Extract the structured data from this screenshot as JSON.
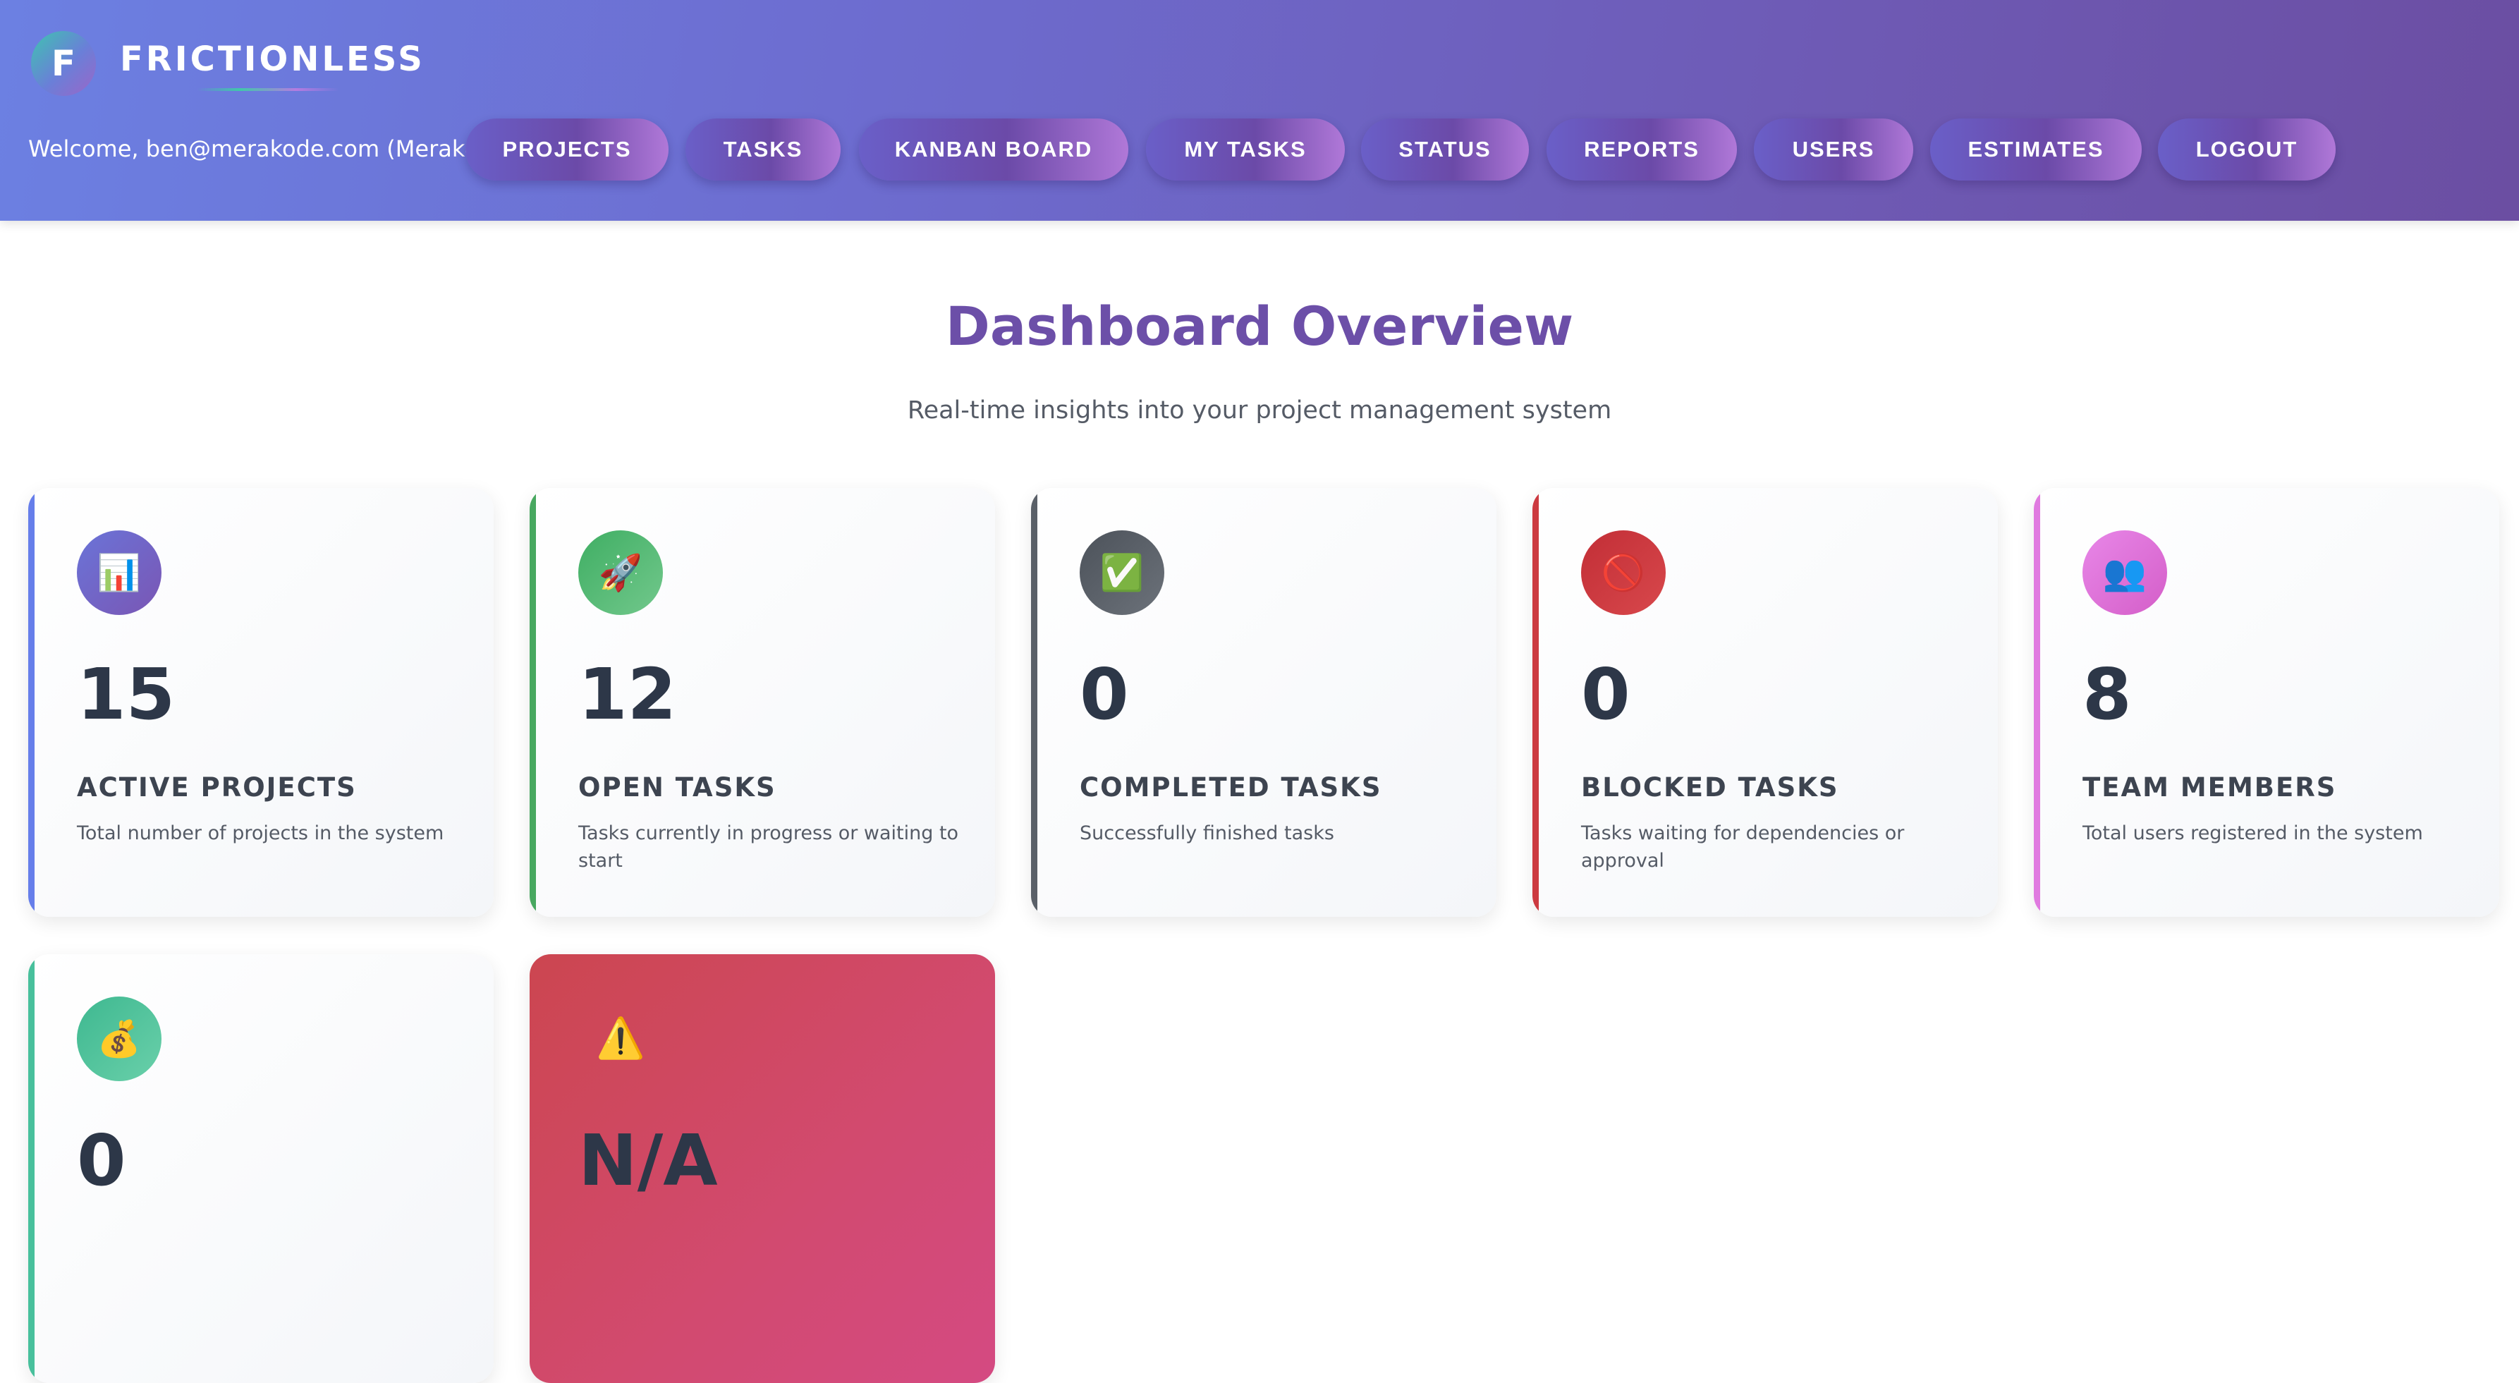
{
  "header": {
    "logo_letter": "F",
    "brand": "FRICTIONLESS",
    "welcome": "Welcome, ben@merakode.com (Merakode)",
    "nav": [
      {
        "label": "PROJECTS"
      },
      {
        "label": "TASKS"
      },
      {
        "label": "KANBAN BOARD"
      },
      {
        "label": "MY TASKS"
      },
      {
        "label": "STATUS"
      },
      {
        "label": "REPORTS"
      },
      {
        "label": "USERS"
      },
      {
        "label": "ESTIMATES"
      },
      {
        "label": "LOGOUT"
      }
    ]
  },
  "main": {
    "title": "Dashboard Overview",
    "subtitle": "Real-time insights into your project management system",
    "cards": [
      {
        "icon": "bar-chart-icon",
        "glyph": "📊",
        "value": "15",
        "label": "ACTIVE PROJECTS",
        "description": "Total number of projects in the system",
        "accent": "#667eea"
      },
      {
        "icon": "rocket-icon",
        "glyph": "🚀",
        "value": "12",
        "label": "OPEN TASKS",
        "description": "Tasks currently in progress or waiting to start",
        "accent": "#48a860"
      },
      {
        "icon": "check-mark-icon",
        "glyph": "✅",
        "value": "0",
        "label": "COMPLETED TASKS",
        "description": "Successfully finished tasks",
        "accent": "#5a6068"
      },
      {
        "icon": "prohibited-icon",
        "glyph": "🚫",
        "value": "0",
        "label": "BLOCKED TASKS",
        "description": "Tasks waiting for dependencies or approval",
        "accent": "#cc3a40"
      },
      {
        "icon": "people-icon",
        "glyph": "👥",
        "value": "8",
        "label": "TEAM MEMBERS",
        "description": "Total users registered in the system",
        "accent": "#e07ae0"
      },
      {
        "icon": "money-bag-icon",
        "glyph": "💰",
        "value": "0",
        "label": "",
        "description": "",
        "accent": "#48c09c"
      },
      {
        "icon": "warning-icon",
        "glyph": "⚠️",
        "value": "N/A",
        "label": "",
        "description": "",
        "accent": "#cc4650"
      }
    ]
  }
}
